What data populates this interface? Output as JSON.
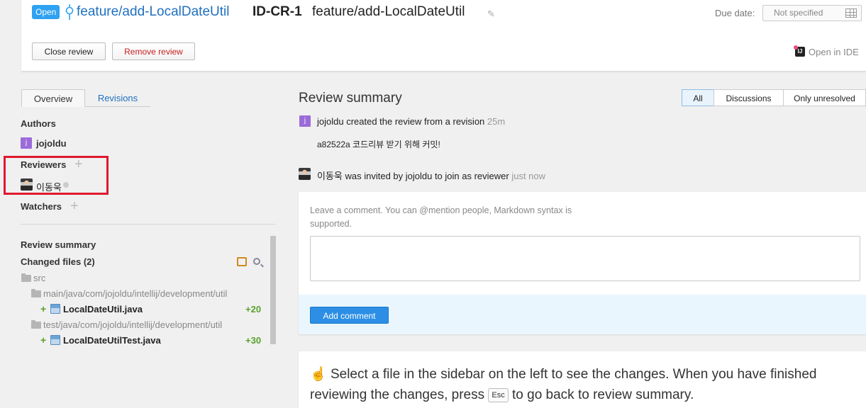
{
  "header": {
    "status": "Open",
    "branch": "feature/add-LocalDateUtil",
    "review_id": "ID-CR-1",
    "title": "feature/add-LocalDateUtil",
    "due_label": "Due date:",
    "due_value": "Not specified",
    "close_label": "Close review",
    "remove_label": "Remove review",
    "open_ide": "Open in IDE"
  },
  "sidebar": {
    "tabs": [
      "Overview",
      "Revisions"
    ],
    "authors_label": "Authors",
    "author": "jojoldu",
    "reviewers_label": "Reviewers",
    "reviewer": "이동욱",
    "watchers_label": "Watchers",
    "summary_label": "Review summary",
    "changed_files_label": "Changed files (2)",
    "tree": {
      "root": "src",
      "dirs": [
        {
          "path": "main/java/com/jojoldu/intellij/development/util",
          "file": "LocalDateUtil.java",
          "added": "+20"
        },
        {
          "path": "test/java/com/jojoldu/intellij/development/util",
          "file": "LocalDateUtilTest.java",
          "added": "+30"
        }
      ]
    }
  },
  "main": {
    "title": "Review summary",
    "filters": [
      "All",
      "Discussions",
      "Only unresolved"
    ],
    "events": [
      {
        "text": "jojoldu created the review from a revision",
        "time": "25m",
        "detail": "a82522a 코드리뷰 받기 위해 커밋!"
      },
      {
        "text": "이동욱 was invited by jojoldu to join as reviewer",
        "time": "just now"
      }
    ],
    "comment_hint": "Leave a comment. You can @mention people, Markdown syntax is supported.",
    "add_comment": "Add comment",
    "info_part1": "Select a file in the sidebar on the left to see the changes. When you have finished reviewing the changes, press",
    "info_key": "Esc",
    "info_part2": "to go back to review summary."
  },
  "colors": {
    "accent": "#2ea1f2",
    "link": "#2070c0",
    "danger": "#c81e1e",
    "added": "#5aa02c",
    "highlight_box": "#e0192f"
  }
}
